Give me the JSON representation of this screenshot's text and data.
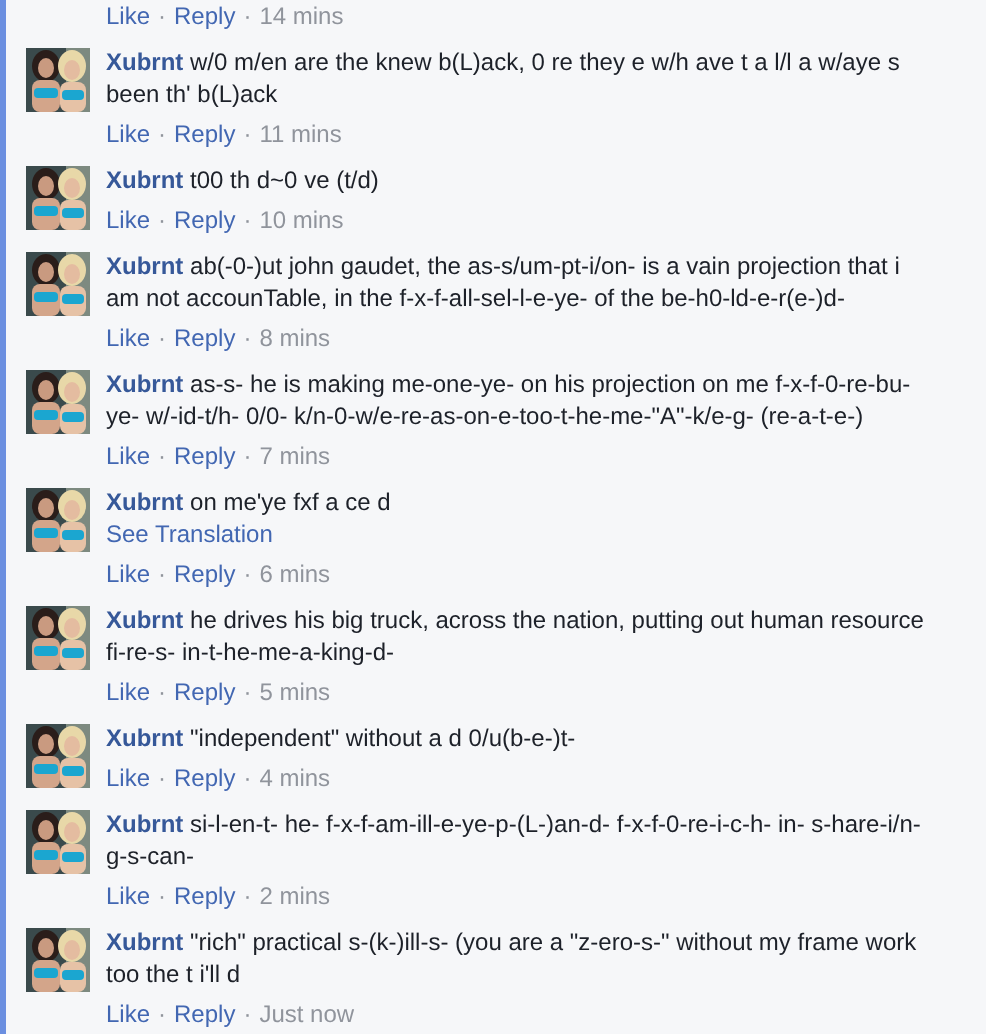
{
  "top_actions": {
    "like": "Like",
    "reply": "Reply",
    "separators": [
      "·",
      "·"
    ],
    "time": "14 mins"
  },
  "comments": [
    {
      "author": "Xubrnt",
      "text": "w/0 m/en are the knew b(L)ack, 0 re they e w/h ave t a l/l a w/aye s been th' b(L)ack",
      "like": "Like",
      "reply": "Reply",
      "separators": [
        "·",
        "·"
      ],
      "time": "11 mins"
    },
    {
      "author": "Xubrnt",
      "text": "t00 th d~0 ve (t/d)",
      "like": "Like",
      "reply": "Reply",
      "separators": [
        "·",
        "·"
      ],
      "time": "10 mins"
    },
    {
      "author": "Xubrnt",
      "text": "ab(-0-)ut john gaudet, the as-s/um-pt-i/on- is a vain projection that i am not accounTable, in the f-x-f-all-sel-l-e-ye- of the be-h0-ld-e-r(e-)d-",
      "like": "Like",
      "reply": "Reply",
      "separators": [
        "·",
        "·"
      ],
      "time": "8 mins"
    },
    {
      "author": "Xubrnt",
      "text": "as-s- he is making me-one-ye- on his projection on me f-x-f-0-re-bu-ye- w/-id-t/h- 0/0- k/n-0-w/e-re-as-on-e-too-t-he-me-\"A\"-k/e-g- (re-a-t-e-)",
      "like": "Like",
      "reply": "Reply",
      "separators": [
        "·",
        "·"
      ],
      "time": "7 mins"
    },
    {
      "author": "Xubrnt",
      "text": "on me'ye fxf a ce d",
      "translation": "See Translation",
      "like": "Like",
      "reply": "Reply",
      "separators": [
        "·",
        "·"
      ],
      "time": "6 mins"
    },
    {
      "author": "Xubrnt",
      "text": "he drives his big truck, across the nation, putting out human resource fi-re-s- in-t-he-me-a-king-d-",
      "like": "Like",
      "reply": "Reply",
      "separators": [
        "·",
        "·"
      ],
      "time": "5 mins"
    },
    {
      "author": "Xubrnt",
      "text": "\"independent\" without a d 0/u(b-e-)t-",
      "like": "Like",
      "reply": "Reply",
      "separators": [
        "·",
        "·"
      ],
      "time": "4 mins"
    },
    {
      "author": "Xubrnt",
      "text": "si-l-en-t- he- f-x-f-am-ill-e-ye-p-(L-)an-d- f-x-f-0-re-i-c-h- in- s-hare-i/n-g-s-can-",
      "like": "Like",
      "reply": "Reply",
      "separators": [
        "·",
        "·"
      ],
      "time": "2 mins"
    },
    {
      "author": "Xubrnt",
      "text": "\"rich\" practical s-(k-)ill-s- (you are a \"z-ero-s-\" without my frame work too the t i'll d",
      "like": "Like",
      "reply": "Reply",
      "separators": [
        "·",
        "·"
      ],
      "time": "Just now"
    }
  ]
}
